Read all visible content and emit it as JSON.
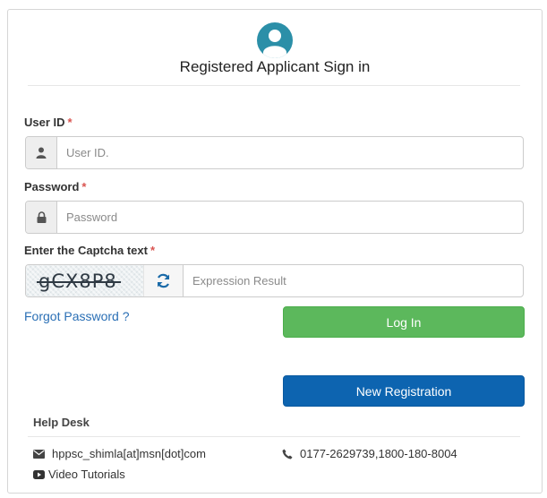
{
  "header": {
    "title": "Registered Applicant Sign in",
    "avatar_icon": "user-circle-icon",
    "accent_color": "#2b8fa8"
  },
  "form": {
    "user_id": {
      "label": "User ID",
      "required_mark": "*",
      "placeholder": "User ID.",
      "value": "",
      "icon": "user-icon"
    },
    "password": {
      "label": "Password",
      "required_mark": "*",
      "placeholder": "Password",
      "value": "",
      "icon": "lock-icon"
    },
    "captcha": {
      "label": "Enter the Captcha text",
      "required_mark": "*",
      "code": "gCX8P8",
      "refresh_icon": "refresh-icon",
      "placeholder": "Expression Result",
      "value": ""
    }
  },
  "links": {
    "forgot_password": "Forgot Password ?"
  },
  "buttons": {
    "login": {
      "label": "Log In",
      "color": "#5cb85c"
    },
    "register": {
      "label": "New Registration",
      "color": "#0d64b0"
    }
  },
  "help_desk": {
    "title": "Help Desk",
    "email": {
      "icon": "envelope-icon",
      "text": "hppsc_shimla[at]msn[dot]com"
    },
    "phone": {
      "icon": "phone-icon",
      "text": "0177-2629739,1800-180-8004"
    },
    "video": {
      "icon": "youtube-icon",
      "text": "Video Tutorials"
    }
  }
}
